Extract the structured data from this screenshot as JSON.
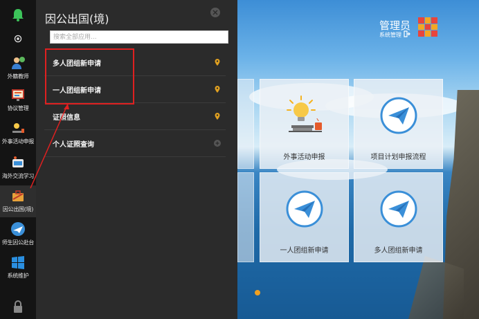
{
  "rail": {
    "items": [
      {
        "label": "",
        "icon": "bell-icon"
      },
      {
        "label": "",
        "icon": "power-icon"
      },
      {
        "label": "外籍教师",
        "icon": "teacher-icon"
      },
      {
        "label": "协议管理",
        "icon": "agreement-icon"
      },
      {
        "label": "外事活动申报",
        "icon": "activity-icon"
      },
      {
        "label": "海外交流学习",
        "icon": "exchange-icon"
      },
      {
        "label": "因公出国(境)",
        "icon": "travel-icon"
      },
      {
        "label": "师生因公赴台",
        "icon": "taiwan-icon"
      },
      {
        "label": "系统维护",
        "icon": "windows-icon"
      },
      {
        "label": "",
        "icon": "lock-icon"
      }
    ]
  },
  "panel": {
    "title": "因公出国(境)",
    "search_placeholder": "搜索全部应用...",
    "menu": [
      {
        "label": "多人团组新申请",
        "icon": "pin-icon"
      },
      {
        "label": "一人团组新申请",
        "icon": "pin-icon"
      },
      {
        "label": "证照信息",
        "icon": "pin-icon"
      },
      {
        "label": "个人证照查询",
        "icon": "plus-icon"
      }
    ]
  },
  "header": {
    "user_name": "管理员",
    "user_sub": "系统管理"
  },
  "tiles": [
    {
      "label": "外事活动申报",
      "icon": "lightbulb-desk-icon"
    },
    {
      "label": "项目计划申报流程",
      "icon": "paper-plane-icon"
    },
    {
      "label": "一人团组新申请",
      "icon": "paper-plane-icon"
    },
    {
      "label": "多人团组新申请",
      "icon": "paper-plane-icon"
    }
  ],
  "colors": {
    "accent_red": "#e02020",
    "pin_yellow": "#e0a020",
    "rail_bg": "#141414",
    "panel_bg": "#2b2b2b"
  }
}
